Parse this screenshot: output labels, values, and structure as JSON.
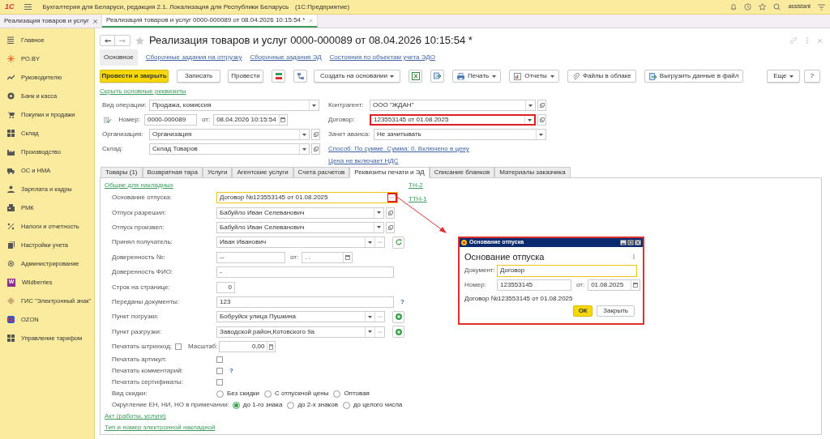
{
  "app": {
    "logo": "1С",
    "title": "Бухгалтерия для Беларуси, редакция 2.1. Локализация для Республики Беларусь",
    "subtitle": "(1С:Предприятие)",
    "user": "assistant"
  },
  "open_tabs": [
    {
      "label": "Реализация товаров и услуг",
      "selected": false
    },
    {
      "label": "Реализация товаров и услуг 0000-000089 от 08.04.2026 10:15:54 *",
      "selected": true
    }
  ],
  "sidebar": [
    {
      "label": "Главное"
    },
    {
      "label": "PO.BY"
    },
    {
      "label": "Руководителю"
    },
    {
      "label": "Банк и касса"
    },
    {
      "label": "Покупки и продажи"
    },
    {
      "label": "Склад"
    },
    {
      "label": "Производство"
    },
    {
      "label": "ОС и НМА"
    },
    {
      "label": "Зарплата и кадры"
    },
    {
      "label": "РМК"
    },
    {
      "label": "Налоги и отчетность"
    },
    {
      "label": "Настройки учета"
    },
    {
      "label": "Администрирование"
    },
    {
      "label": "Wildberries",
      "badge": "W"
    },
    {
      "label": "ГИС \"Электронный знак\""
    },
    {
      "label": "OZON"
    },
    {
      "label": "Управление тарифом"
    }
  ],
  "form": {
    "title": "Реализация товаров и услуг 0000-000089 от 08.04.2026 10:15:54 *",
    "sections": [
      {
        "label": "Основное",
        "selected": true
      },
      {
        "label": "Сборочные задания на отгрузку",
        "selected": false
      },
      {
        "label": "Сборочные задания ЭД",
        "selected": false
      },
      {
        "label": "Состояния по объектам учета ЭДО",
        "selected": false
      }
    ],
    "toolbar": {
      "post_close": "Провести и закрыть",
      "save": "Записать",
      "post": "Провести",
      "create": "Создать на основании",
      "print": "Печать",
      "reports": "Отчеты",
      "files": "Файлы в облаке",
      "export": "Выгрузить данные в файл",
      "more": "Еще",
      "help": "?"
    },
    "hide_link": "Скрыть основные реквизиты",
    "operation": {
      "label": "Вид операции:",
      "value": "Продажа, комиссия"
    },
    "number": {
      "label": "Номер:",
      "value": "0000-000089",
      "date_label": "от:",
      "date": "08.04.2026 10:15:54"
    },
    "organization": {
      "label": "Организация:",
      "value": "Организация"
    },
    "warehouse": {
      "label": "Склад:",
      "value": "Склад Товаров"
    },
    "counterparty": {
      "label": "Контрагент:",
      "value": "ООО \"ЖДАН\""
    },
    "contract": {
      "label": "Договор:",
      "value": "123553145 от 01.08.2025",
      "highlighted": true
    },
    "advance": {
      "label": "Зачет аванса:",
      "value": "Не зачитывать"
    },
    "payment_link": "Способ: По сумме. Сумма: 0. Включено в цену",
    "vat_link": "Цена не включает НДС",
    "tabs": [
      {
        "label": "Товары (1)",
        "selected": false
      },
      {
        "label": "Возвратная тара",
        "selected": false
      },
      {
        "label": "Услуги",
        "selected": false
      },
      {
        "label": "Агентские услуги",
        "selected": false
      },
      {
        "label": "Счета расчетов",
        "selected": false
      },
      {
        "label": "Реквизиты печати и ЭД",
        "selected": true
      },
      {
        "label": "Списание бланков",
        "selected": false
      },
      {
        "label": "Материалы заказчика",
        "selected": false
      }
    ],
    "print_details": {
      "group_link": "Общие для накладных",
      "side_links": [
        "ТН-2",
        "ТТН-1"
      ],
      "rows": [
        {
          "kind": "pick",
          "label": "Основание отпуска:",
          "value": "Договор №123553145 от 01.08.2025",
          "focused": true,
          "highlighted": true
        },
        {
          "kind": "select",
          "label": "Отпуск разрешил:",
          "value": "Бабуйло Иван Селеванович"
        },
        {
          "kind": "select",
          "label": "Отпуск произвел:",
          "value": "Бабуйло Иван Селеванович"
        },
        {
          "kind": "refreshable",
          "label": "Принял получатель:",
          "value": "Иван Иванович"
        },
        {
          "kind": "number_date",
          "label": "Доверенность №:",
          "value": "--",
          "date_label": "от:",
          "date": ".  ."
        },
        {
          "kind": "text",
          "label": "Доверенность ФИО:",
          "value": "-"
        },
        {
          "kind": "short",
          "label": "Строк на странице:",
          "value": "0"
        },
        {
          "kind": "text",
          "label": "Переданы документы:",
          "value": "123",
          "help": "?"
        },
        {
          "kind": "addable",
          "label": "Пункт погрузки:",
          "value": "Бобруйск улица Пушкина"
        },
        {
          "kind": "addable",
          "label": "Пункт разгрузки:",
          "value": "Заводской район,Котовского 9а"
        },
        {
          "kind": "checkbox_scale",
          "label": "Печатать штрихкод:",
          "checked": false,
          "scale_label": "Масштаб:",
          "scale": "0,00"
        },
        {
          "kind": "checkbox",
          "label": "Печатать артикул:",
          "checked": false
        },
        {
          "kind": "checkbox",
          "label": "Печатать комментарий:",
          "checked": false,
          "help": "?"
        },
        {
          "kind": "checkbox",
          "label": "Печатать сертификаты:",
          "checked": false
        },
        {
          "kind": "radio",
          "label": "Вид скидки:",
          "options": [
            {
              "label": "Без скидки",
              "selected": false
            },
            {
              "label": "С отпускной цены",
              "selected": false
            },
            {
              "label": "Оптовая",
              "selected": false
            }
          ]
        },
        {
          "kind": "radio",
          "label": "Округление ЕН, НИ, НО в примечании:",
          "options": [
            {
              "label": "до 1-го знака",
              "selected": true
            },
            {
              "label": "до 2-х знаков",
              "selected": false
            },
            {
              "label": "до целого числа",
              "selected": false
            }
          ]
        }
      ],
      "links": [
        "Акт (работы, услуги)",
        "Тип и номер электронной накладной"
      ]
    }
  },
  "dialog": {
    "window_title": "Основание отпуска",
    "heading": "Основание отпуска",
    "document_label": "Документ:",
    "document": "Договор",
    "number_label": "Номер:",
    "number": "123553145",
    "date_label": "от:",
    "date": "01.08.2025",
    "result": "Договор №123553145 от 01.08.2025",
    "ok": "ОК",
    "close": "Закрыть"
  }
}
